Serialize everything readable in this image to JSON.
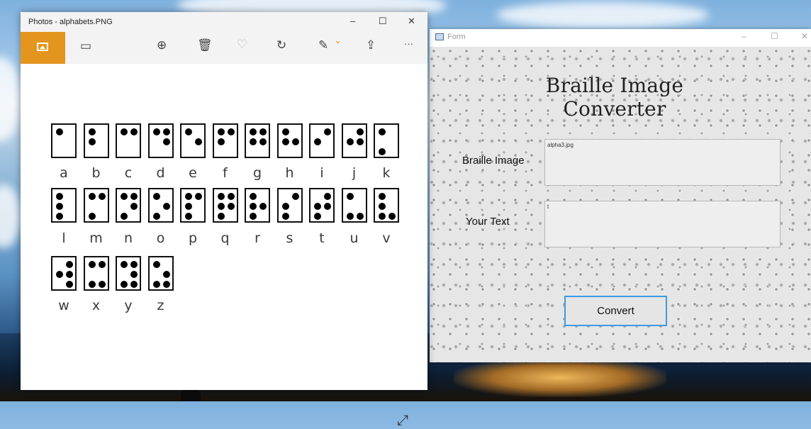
{
  "desktop": {
    "background": "sky-and-lake-wallpaper"
  },
  "photos_window": {
    "title": "Photos - alphabets.PNG",
    "window_buttons": {
      "minimize": "–",
      "maximize": "☐",
      "close": "✕"
    },
    "toolbar": {
      "view_icon": "image-icon",
      "slideshow": "▭",
      "zoom": "⊕",
      "delete": "🗑",
      "favorite": "♡",
      "rotate": "↻",
      "edit": "✎",
      "edit_chevron": "⌄",
      "share": "⇪",
      "more": "···"
    },
    "expand_icon": "⤢",
    "braille_chart": {
      "rows": [
        [
          {
            "letter": "a",
            "dots": [
              1
            ]
          },
          {
            "letter": "b",
            "dots": [
              1,
              2
            ]
          },
          {
            "letter": "c",
            "dots": [
              1,
              4
            ]
          },
          {
            "letter": "d",
            "dots": [
              1,
              4,
              5
            ]
          },
          {
            "letter": "e",
            "dots": [
              1,
              5
            ]
          },
          {
            "letter": "f",
            "dots": [
              1,
              2,
              4
            ]
          },
          {
            "letter": "g",
            "dots": [
              1,
              2,
              4,
              5
            ]
          },
          {
            "letter": "h",
            "dots": [
              1,
              2,
              5
            ]
          },
          {
            "letter": "i",
            "dots": [
              2,
              4
            ]
          },
          {
            "letter": "j",
            "dots": [
              2,
              4,
              5
            ]
          },
          {
            "letter": "k",
            "dots": [
              1,
              3
            ]
          }
        ],
        [
          {
            "letter": "l",
            "dots": [
              1,
              2,
              3
            ]
          },
          {
            "letter": "m",
            "dots": [
              1,
              3,
              4
            ]
          },
          {
            "letter": "n",
            "dots": [
              1,
              3,
              4,
              5
            ]
          },
          {
            "letter": "o",
            "dots": [
              1,
              3,
              5
            ]
          },
          {
            "letter": "p",
            "dots": [
              1,
              2,
              3,
              4
            ]
          },
          {
            "letter": "q",
            "dots": [
              1,
              2,
              3,
              4,
              5
            ]
          },
          {
            "letter": "r",
            "dots": [
              1,
              2,
              3,
              5
            ]
          },
          {
            "letter": "s",
            "dots": [
              2,
              3,
              4
            ]
          },
          {
            "letter": "t",
            "dots": [
              2,
              3,
              4,
              5
            ]
          },
          {
            "letter": "u",
            "dots": [
              1,
              3,
              6
            ]
          },
          {
            "letter": "v",
            "dots": [
              1,
              2,
              3,
              6
            ]
          }
        ],
        [
          {
            "letter": "w",
            "dots": [
              2,
              4,
              5,
              6
            ]
          },
          {
            "letter": "x",
            "dots": [
              1,
              3,
              4,
              6
            ]
          },
          {
            "letter": "y",
            "dots": [
              1,
              3,
              4,
              5,
              6
            ]
          },
          {
            "letter": "z",
            "dots": [
              1,
              3,
              5,
              6
            ]
          }
        ]
      ]
    }
  },
  "form_window": {
    "title": "Form",
    "window_buttons": {
      "minimize": "–",
      "maximize": "☐",
      "close": "✕"
    },
    "heading": "Braille Image Converter",
    "braille_image_label": "Braille Image",
    "braille_image_value": "alpha3.jpg",
    "your_text_label": "Your Text",
    "your_text_value": "t",
    "convert_button": "Convert",
    "accent_color": "#3d9ae5"
  }
}
